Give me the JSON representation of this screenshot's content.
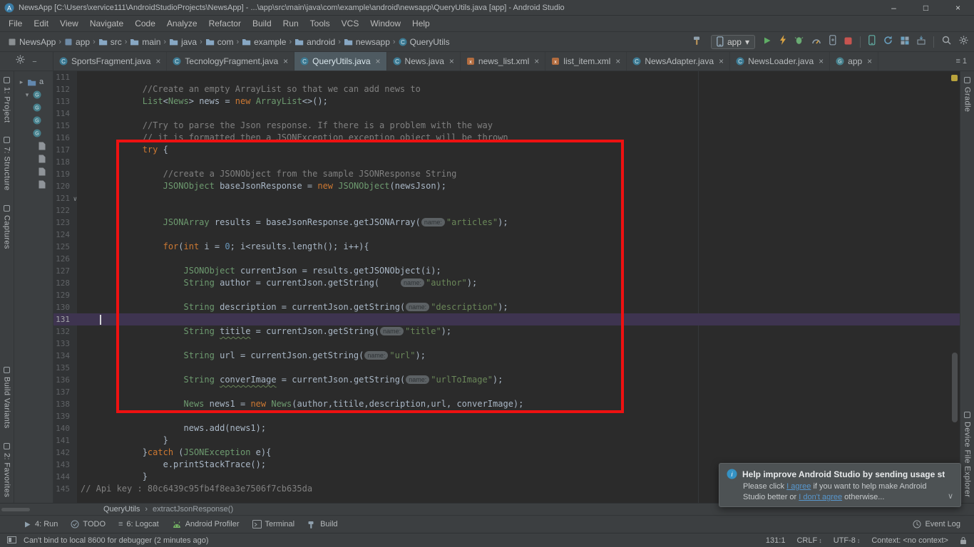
{
  "colors": {
    "chrome_bg": "#3c3f41",
    "editor_bg": "#2b2b2b",
    "gutter_bg": "#313335",
    "annotation_red": "#ee1111",
    "run_green": "#5fad65",
    "stop_red": "#c75450",
    "link_blue": "#5897cd",
    "caret_line_purple": "#3e3450",
    "keyword_orange": "#cc7832",
    "string_green": "#6a8759",
    "comment_gray": "#808080",
    "number_blue": "#6897bb"
  },
  "titlebar": {
    "title": "NewsApp [C:\\Users\\xervice111\\AndroidStudioProjects\\NewsApp] - ...\\app\\src\\main\\java\\com\\example\\android\\newsapp\\QueryUtils.java [app] - Android Studio",
    "minimize": "–",
    "maximize": "□",
    "close": "×"
  },
  "menubar": [
    "File",
    "Edit",
    "View",
    "Navigate",
    "Code",
    "Analyze",
    "Refactor",
    "Build",
    "Run",
    "Tools",
    "VCS",
    "Window",
    "Help"
  ],
  "navbar": {
    "crumbs": [
      {
        "label": "NewsApp",
        "icon": "project-icon"
      },
      {
        "label": "app",
        "icon": "module-icon"
      },
      {
        "label": "src",
        "icon": "folder-icon"
      },
      {
        "label": "main",
        "icon": "folder-icon"
      },
      {
        "label": "java",
        "icon": "folder-icon"
      },
      {
        "label": "com",
        "icon": "folder-icon"
      },
      {
        "label": "example",
        "icon": "folder-icon"
      },
      {
        "label": "android",
        "icon": "folder-icon"
      },
      {
        "label": "newsapp",
        "icon": "folder-icon"
      },
      {
        "label": "QueryUtils",
        "icon": "class-icon"
      }
    ],
    "actions": [
      {
        "type": "icon",
        "name": "make-project-button",
        "icon": "hammer-icon"
      },
      {
        "type": "dropdown",
        "name": "run-config-dropdown",
        "icon": "device-icon",
        "label": "app",
        "chevron": "▾"
      },
      {
        "type": "icon",
        "name": "run-button",
        "icon": "play-icon"
      },
      {
        "type": "icon",
        "name": "apply-changes-button",
        "icon": "lightning-icon"
      },
      {
        "type": "icon",
        "name": "debug-button",
        "icon": "bug-icon"
      },
      {
        "type": "icon",
        "name": "profile-button",
        "icon": "gauge-icon"
      },
      {
        "type": "icon",
        "name": "attach-debugger-button",
        "icon": "attach-icon"
      },
      {
        "type": "icon",
        "name": "stop-button",
        "icon": "stop-icon"
      },
      {
        "type": "sep"
      },
      {
        "type": "icon",
        "name": "device-manager-button",
        "icon": "device-teal-icon"
      },
      {
        "type": "icon",
        "name": "sync-project-button",
        "icon": "sync-icon"
      },
      {
        "type": "icon",
        "name": "layout-inspector-button",
        "icon": "layout-icon"
      },
      {
        "type": "icon",
        "name": "sdk-manager-button",
        "icon": "sdk-icon"
      },
      {
        "type": "sep"
      },
      {
        "type": "icon",
        "name": "search-everywhere-button",
        "icon": "search-icon"
      },
      {
        "type": "icon",
        "name": "settings-button",
        "icon": "gear-icon"
      }
    ]
  },
  "tabs": {
    "items": [
      {
        "label": "SportsFragment.java",
        "icon": "class-icon",
        "selected": false
      },
      {
        "label": "TecnologyFragment.java",
        "icon": "class-icon",
        "selected": false
      },
      {
        "label": "QueryUtils.java",
        "icon": "class-icon",
        "selected": true
      },
      {
        "label": "News.java",
        "icon": "class-icon",
        "selected": false
      },
      {
        "label": "news_list.xml",
        "icon": "xml-icon",
        "selected": false
      },
      {
        "label": "list_item.xml",
        "icon": "xml-icon",
        "selected": false
      },
      {
        "label": "NewsAdapter.java",
        "icon": "class-icon",
        "selected": false
      },
      {
        "label": "NewsLoader.java",
        "icon": "class-icon",
        "selected": false
      },
      {
        "label": "app",
        "icon": "gradle-circle-icon",
        "selected": false
      }
    ],
    "hidden_count": "1"
  },
  "left_stripe": {
    "top": [
      "1: Project",
      "7: Structure",
      "Captures"
    ],
    "bottom": [
      "Build Variants",
      "2: Favorites"
    ]
  },
  "right_stripe": {
    "top": [
      "Gradle"
    ],
    "bottom": [
      "Device File Explorer"
    ]
  },
  "project_panel": {
    "rows": [
      {
        "icon": "folder-blue-icon",
        "arrow": "▸",
        "label": "a",
        "indent": 0
      },
      {
        "icon": "gradle-circle-icon",
        "arrow": "▾",
        "indent": 1
      },
      {
        "icon": "gradle-circle-icon",
        "indent": 1
      },
      {
        "icon": "gradle-circle-icon",
        "indent": 1
      },
      {
        "icon": "gradle-circle-icon",
        "indent": 1
      },
      {
        "icon": "file-icon",
        "indent": 2
      },
      {
        "icon": "file-icon",
        "indent": 2
      },
      {
        "icon": "file-icon",
        "indent": 2
      },
      {
        "icon": "file-icon",
        "indent": 2
      }
    ]
  },
  "editor": {
    "lines": [
      {
        "n": 111,
        "s": []
      },
      {
        "n": 112,
        "s": [
          [
            "p",
            "            "
          ],
          [
            "c",
            "//Create an empty ArrayList so that we can add news to"
          ]
        ]
      },
      {
        "n": 113,
        "s": [
          [
            "p",
            "            "
          ],
          [
            "t",
            "List"
          ],
          [
            "p",
            "<"
          ],
          [
            "t",
            "News"
          ],
          [
            "p",
            "> news = "
          ],
          [
            "k",
            "new"
          ],
          [
            "p",
            " "
          ],
          [
            "t",
            "ArrayList"
          ],
          [
            "p",
            "<>();"
          ]
        ]
      },
      {
        "n": 114,
        "s": []
      },
      {
        "n": 115,
        "s": [
          [
            "p",
            "            "
          ],
          [
            "c",
            "//Try to parse the Json response. If there is a problem with the way"
          ]
        ]
      },
      {
        "n": 116,
        "s": [
          [
            "p",
            "            "
          ],
          [
            "c",
            "// it is formatted then a JSONException exception object will be thrown"
          ]
        ]
      },
      {
        "n": 117,
        "s": [
          [
            "p",
            "            "
          ],
          [
            "k",
            "try"
          ],
          [
            "p",
            " {"
          ]
        ]
      },
      {
        "n": 118,
        "s": []
      },
      {
        "n": 119,
        "s": [
          [
            "p",
            "                "
          ],
          [
            "c",
            "//create a JSONObject from the sample JSONResponse String"
          ]
        ]
      },
      {
        "n": 120,
        "s": [
          [
            "p",
            "                "
          ],
          [
            "t",
            "JSONObject"
          ],
          [
            "p",
            " baseJsonResponse = "
          ],
          [
            "k",
            "new"
          ],
          [
            "p",
            " "
          ],
          [
            "t",
            "JSONObject"
          ],
          [
            "p",
            "(newsJson);"
          ]
        ]
      },
      {
        "n": 121,
        "fold": true,
        "s": []
      },
      {
        "n": 122,
        "s": []
      },
      {
        "n": 123,
        "s": [
          [
            "p",
            "                "
          ],
          [
            "t",
            "JSONArray"
          ],
          [
            "p",
            " results = baseJsonResponse.getJSONArray("
          ],
          [
            "h",
            "name:"
          ],
          [
            "s",
            "\"articles\""
          ],
          [
            "p",
            ");"
          ]
        ]
      },
      {
        "n": 124,
        "s": []
      },
      {
        "n": 125,
        "s": [
          [
            "p",
            "                "
          ],
          [
            "k",
            "for"
          ],
          [
            "p",
            "("
          ],
          [
            "k",
            "int"
          ],
          [
            "p",
            " i = "
          ],
          [
            "n",
            "0"
          ],
          [
            "p",
            "; i<results.length(); i++){"
          ]
        ]
      },
      {
        "n": 126,
        "s": []
      },
      {
        "n": 127,
        "s": [
          [
            "p",
            "                    "
          ],
          [
            "t",
            "JSONObject"
          ],
          [
            "p",
            " currentJson = results.getJSONObject(i);"
          ]
        ]
      },
      {
        "n": 128,
        "s": [
          [
            "p",
            "                    "
          ],
          [
            "t",
            "String"
          ],
          [
            "p",
            " author = currentJson.getString(    "
          ],
          [
            "h",
            "name:"
          ],
          [
            "s",
            "\"author\""
          ],
          [
            "p",
            ");"
          ]
        ]
      },
      {
        "n": 129,
        "s": []
      },
      {
        "n": 130,
        "s": [
          [
            "p",
            "                    "
          ],
          [
            "t",
            "String"
          ],
          [
            "p",
            " description = currentJson.getString("
          ],
          [
            "h",
            "name:"
          ],
          [
            "s",
            "\"description\""
          ],
          [
            "p",
            ");"
          ]
        ]
      },
      {
        "n": 131,
        "caret": true,
        "s": []
      },
      {
        "n": 132,
        "s": [
          [
            "p",
            "                    "
          ],
          [
            "t",
            "String"
          ],
          [
            "p",
            " "
          ],
          [
            "w",
            "titile"
          ],
          [
            "p",
            " = currentJson.getString("
          ],
          [
            "h",
            "name:"
          ],
          [
            "s",
            "\"title\""
          ],
          [
            "p",
            ");"
          ]
        ]
      },
      {
        "n": 133,
        "s": []
      },
      {
        "n": 134,
        "s": [
          [
            "p",
            "                    "
          ],
          [
            "t",
            "String"
          ],
          [
            "p",
            " url = currentJson.getString("
          ],
          [
            "h",
            "name:"
          ],
          [
            "s",
            "\"url\""
          ],
          [
            "p",
            ");"
          ]
        ]
      },
      {
        "n": 135,
        "s": []
      },
      {
        "n": 136,
        "s": [
          [
            "p",
            "                    "
          ],
          [
            "t",
            "String"
          ],
          [
            "p",
            " "
          ],
          [
            "w",
            "converImage"
          ],
          [
            "p",
            " = currentJson.getString("
          ],
          [
            "h",
            "name:"
          ],
          [
            "s",
            "\"urlToImage\""
          ],
          [
            "p",
            ");"
          ]
        ]
      },
      {
        "n": 137,
        "s": []
      },
      {
        "n": 138,
        "s": [
          [
            "p",
            "                    "
          ],
          [
            "t",
            "News"
          ],
          [
            "p",
            " news1 = "
          ],
          [
            "k",
            "new"
          ],
          [
            "p",
            " "
          ],
          [
            "t",
            "News"
          ],
          [
            "p",
            "(author,titile,description,url, converImage);"
          ]
        ]
      },
      {
        "n": 139,
        "s": []
      },
      {
        "n": 140,
        "s": [
          [
            "p",
            "                    news.add(news1);"
          ]
        ]
      },
      {
        "n": 141,
        "s": [
          [
            "p",
            "                }"
          ]
        ]
      },
      {
        "n": 142,
        "s": [
          [
            "p",
            "            }"
          ],
          [
            "k",
            "catch"
          ],
          [
            "p",
            " ("
          ],
          [
            "t",
            "JSONException"
          ],
          [
            "p",
            " e){"
          ]
        ]
      },
      {
        "n": 143,
        "s": [
          [
            "p",
            "                e.printStackTrace();"
          ]
        ]
      },
      {
        "n": 144,
        "s": [
          [
            "p",
            "            }"
          ]
        ]
      },
      {
        "n": 145,
        "s": [
          [
            "c",
            "// Api key : 80c6439c95fb4f8ea3e7506f7cb635da"
          ]
        ]
      }
    ]
  },
  "breadcrumbs": {
    "items": [
      "QueryUtils",
      "extractJsonResponse()"
    ]
  },
  "tool_buttons": {
    "left": [
      {
        "label": "4: Run",
        "icon": "run-tool-icon"
      },
      {
        "label": "TODO",
        "icon": "todo-icon"
      },
      {
        "label": "6: Logcat",
        "icon": "list-icon"
      },
      {
        "label": "Android Profiler",
        "icon": "android-icon"
      },
      {
        "label": "Terminal",
        "icon": "terminal-icon"
      },
      {
        "label": "Build",
        "icon": "build-icon"
      }
    ],
    "right": [
      {
        "label": "Event Log",
        "icon": "eventlog-icon"
      }
    ]
  },
  "statusbar": {
    "message": "Can't bind to local 8600 for debugger (2 minutes ago)",
    "items": [
      {
        "label": "131:1"
      },
      {
        "label": "CRLF",
        "arrow": true
      },
      {
        "label": "UTF-8",
        "arrow": true
      },
      {
        "label": "Context: <no context>"
      }
    ]
  },
  "notification": {
    "title": "Help improve Android Studio by sending usage st",
    "body_pre": "Please click ",
    "link1": "I agree",
    "body_mid": " if you want to help make Android Studio better or ",
    "link2": "I don't agree",
    "body_post": " otherwise..."
  }
}
